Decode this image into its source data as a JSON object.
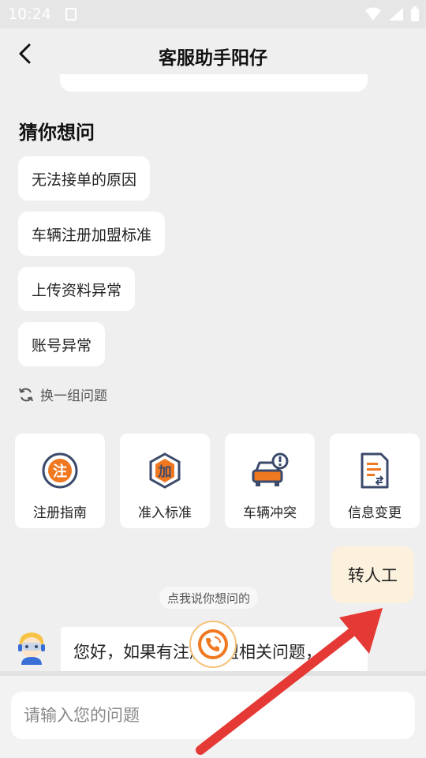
{
  "status_bar": {
    "time": "10:24"
  },
  "header": {
    "title": "客服助手阳仔"
  },
  "suggestions": {
    "title": "猜你想问",
    "items": [
      "无法接单的原因",
      "车辆注册加盟标准",
      "上传资料异常",
      "账号异常"
    ],
    "refresh_label": "换一组问题"
  },
  "categories": [
    {
      "label": "注册指南",
      "icon_char": "注"
    },
    {
      "label": "准入标准",
      "icon_char": "加"
    },
    {
      "label": "车辆冲突",
      "icon_char": ""
    },
    {
      "label": "信息变更",
      "icon_char": ""
    }
  ],
  "transfer_button": {
    "label": "转人工"
  },
  "voice_hint": "点我说你想问的",
  "chat": {
    "message": "您好，如果有注册加盟相关问题，"
  },
  "input": {
    "placeholder": "请输入您的问题"
  },
  "colors": {
    "accent_orange": "#f07820",
    "icon_navy": "#3b4a6b",
    "annotation_red": "#e53935"
  }
}
